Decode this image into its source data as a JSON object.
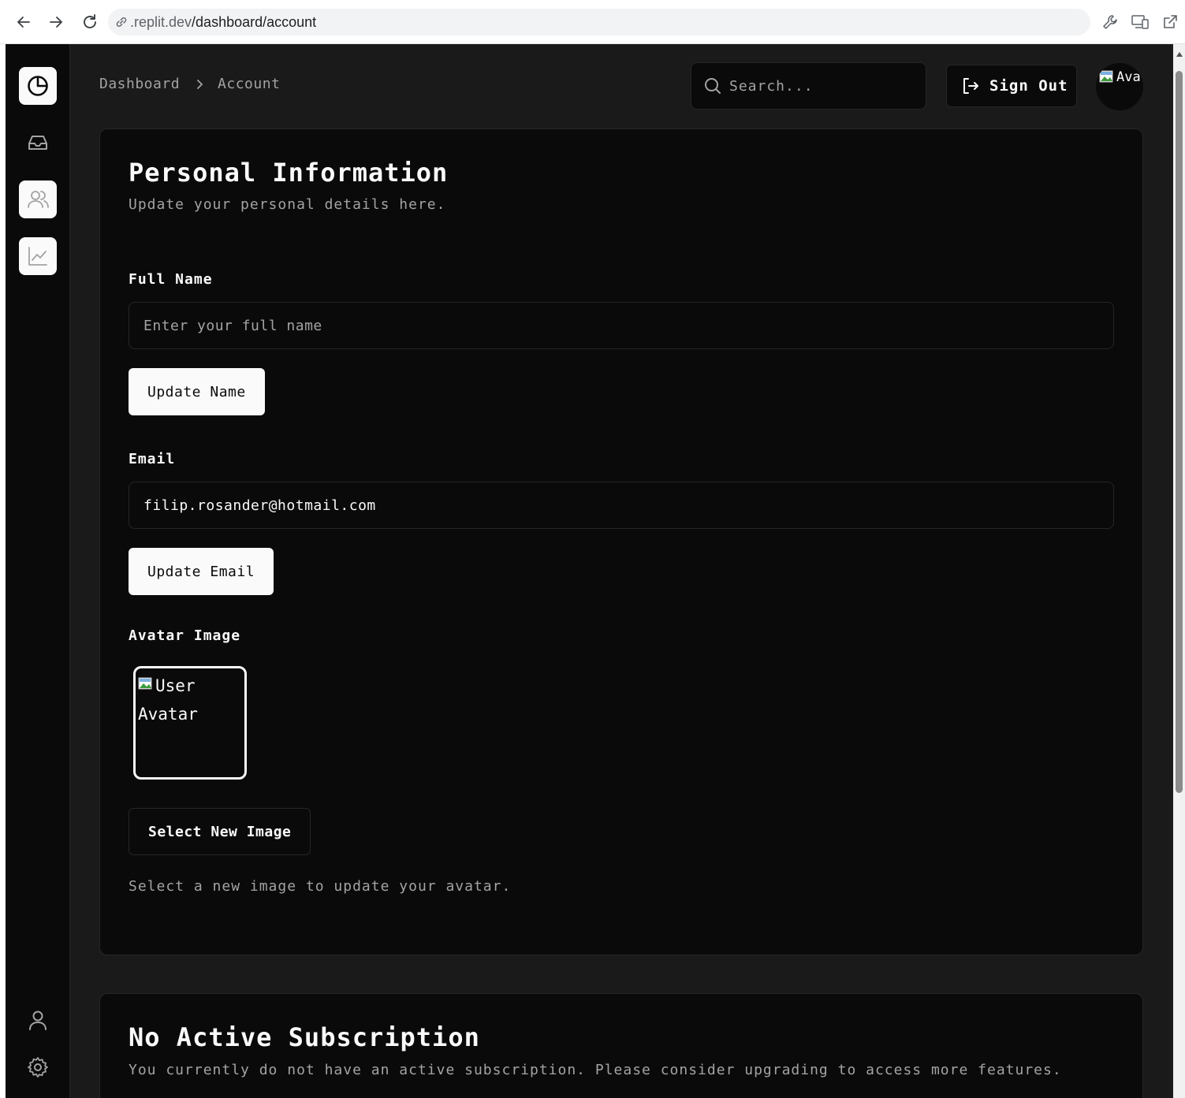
{
  "browser": {
    "url_prefix": ".replit.dev",
    "url_path": "/dashboard/account"
  },
  "sidebar": {
    "items": [
      {
        "name": "dashboard",
        "icon": "pie-chart-icon",
        "state": "active"
      },
      {
        "name": "inbox",
        "icon": "inbox-icon",
        "state": "default"
      },
      {
        "name": "users",
        "icon": "users-icon",
        "state": "highlighted"
      },
      {
        "name": "analytics",
        "icon": "line-chart-icon",
        "state": "highlighted"
      }
    ],
    "bottom_items": [
      {
        "name": "account",
        "icon": "user-icon"
      },
      {
        "name": "settings",
        "icon": "gear-icon"
      }
    ]
  },
  "header": {
    "breadcrumb": [
      "Dashboard",
      "Account"
    ],
    "search_placeholder": "Search...",
    "sign_out_label": "Sign Out",
    "avatar_alt": "Avatar"
  },
  "personal_info": {
    "title": "Personal Information",
    "description": "Update your personal details here.",
    "full_name_label": "Full Name",
    "full_name_placeholder": "Enter your full name",
    "full_name_value": "",
    "update_name_label": "Update Name",
    "email_label": "Email",
    "email_value": "filip.rosander@hotmail.com",
    "update_email_label": "Update Email",
    "avatar_label": "Avatar Image",
    "avatar_alt": "User Avatar",
    "select_image_label": "Select New Image",
    "avatar_help": "Select a new image to update your avatar."
  },
  "subscription": {
    "title": "No Active Subscription",
    "description": "You currently do not have an active subscription. Please consider upgrading to access more features."
  },
  "colors": {
    "background": "#0a0a0a",
    "app_backdrop": "#1a1a1a",
    "border": "#262626",
    "text": "#fafafa",
    "muted_text": "#a3a3a3"
  }
}
